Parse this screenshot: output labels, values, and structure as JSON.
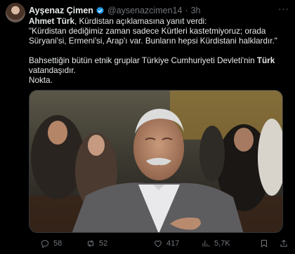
{
  "author": {
    "name": "Ayşenaz Çimen",
    "handle": "@aysenazcimen14",
    "time": "3h",
    "verified_color": "#1d9bf0"
  },
  "tweet": {
    "l1_bold": "Ahmet Türk",
    "l1_rest": ", Kürdistan açıklamasına yanıt verdi:",
    "l2": "\"Kürdistan dediğimiz zaman sadece Kürtleri kastetmiyoruz; orada",
    "l3": "Süryani'si, Ermeni'si, Arap'ı var. Bunların hepsi Kürdistani halklardır.\"",
    "l4_pre": "Bahsettiğin bütün etnik gruplar Türkiye Cumhuriyeti Devleti'nin ",
    "l4_bold": "Türk",
    "l5": "vatandaşıdır.",
    "l6": "Nokta."
  },
  "actions": {
    "replies": "58",
    "retweets": "52",
    "likes": "417",
    "views": "5,7K"
  },
  "icons": {
    "more": "more-icon",
    "reply": "reply-icon",
    "retweet": "retweet-icon",
    "like": "heart-icon",
    "views": "views-icon",
    "bookmark": "bookmark-icon",
    "share": "share-icon"
  }
}
